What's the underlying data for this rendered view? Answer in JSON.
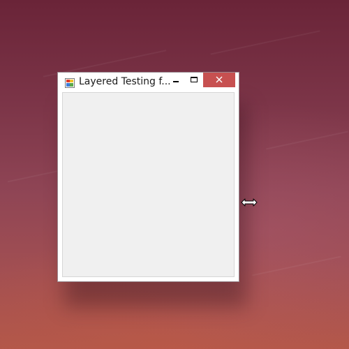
{
  "window": {
    "title": "Layered Testing f...",
    "app_icon": "windows-form-icon",
    "controls": {
      "minimize_icon": "minimize-icon",
      "maximize_icon": "maximize-icon",
      "close_icon": "close-icon",
      "close_color": "#c75050"
    },
    "client_color": "#f0f0f0"
  },
  "cursor": {
    "icon": "resize-horizontal-cursor-icon"
  }
}
